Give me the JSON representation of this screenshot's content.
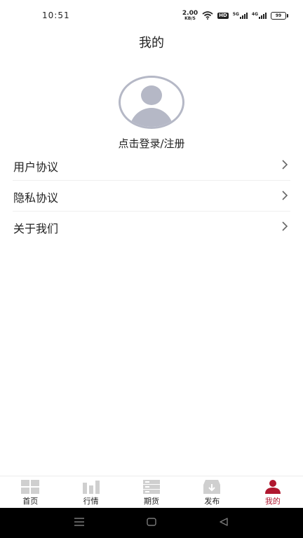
{
  "status_bar": {
    "time": "10:51",
    "net_speed_value": "2.00",
    "net_speed_unit": "KB/S",
    "hd_badge": "HD",
    "sim1_type": "5G",
    "sim2_type": "4G",
    "battery_level": "99"
  },
  "header": {
    "title": "我的"
  },
  "profile": {
    "login_text": "点击登录/注册"
  },
  "menu": {
    "items": [
      {
        "label": "用户协议"
      },
      {
        "label": "隐私协议"
      },
      {
        "label": "关于我们"
      }
    ]
  },
  "tab_bar": {
    "active_tab": "我的",
    "tabs": [
      {
        "label": "首页",
        "icon": "grid-icon"
      },
      {
        "label": "行情",
        "icon": "bar-chart-icon"
      },
      {
        "label": "期货",
        "icon": "server-stack-icon"
      },
      {
        "label": "发布",
        "icon": "inbox-download-icon"
      },
      {
        "label": "我的",
        "icon": "person-icon"
      }
    ]
  },
  "colors": {
    "accent": "#b0172f",
    "tab_icon_inactive": "#cfcfcf",
    "avatar": "#b5b8c6"
  }
}
